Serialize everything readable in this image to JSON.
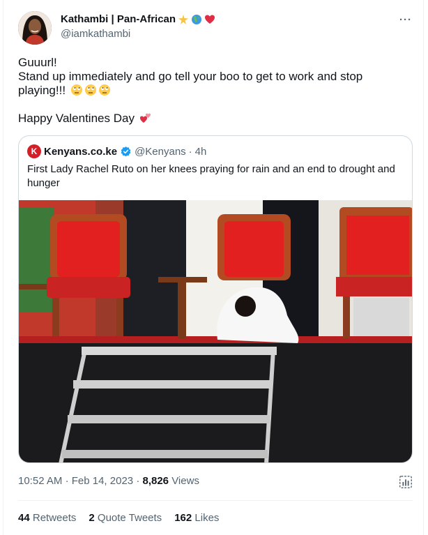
{
  "author": {
    "display_name": "Kathambi | Pan-African",
    "handle": "@iamkathambi",
    "badges": [
      "sparkle-star-emoji",
      "globe-africa-emoji",
      "red-heart-emoji"
    ]
  },
  "menu": {
    "more_label": "···"
  },
  "tweet": {
    "line1": "Guuurl!",
    "line2": "Stand up immediately and go tell your boo to get to work and stop playing!!!",
    "line2_emojis": [
      "rolling-eyes-emoji",
      "rolling-eyes-emoji",
      "rolling-eyes-emoji"
    ],
    "line3": "Happy Valentines Day",
    "line3_emoji": "two-hearts-emoji"
  },
  "quoted": {
    "logo_letter": "K",
    "display_name": "Kenyans.co.ke",
    "verified": true,
    "handle": "@Kenyans",
    "separator": "·",
    "time": "4h",
    "text": "First Lady Rachel Ruto on her knees praying for rain and an end to drought and hunger"
  },
  "meta": {
    "time": "10:52 AM",
    "separator": "·",
    "date": "Feb 14, 2023",
    "separator2": "·",
    "views_count": "8,826",
    "views_label": "Views"
  },
  "stats": {
    "retweets_count": "44",
    "retweets_label": "Retweets",
    "quotes_count": "2",
    "quotes_label": "Quote Tweets",
    "likes_count": "162",
    "likes_label": "Likes"
  },
  "colors": {
    "text": "#0f1419",
    "secondary": "#536471",
    "border": "#cfd9de",
    "verified": "#1d9bf0",
    "heart": "#f91880"
  }
}
